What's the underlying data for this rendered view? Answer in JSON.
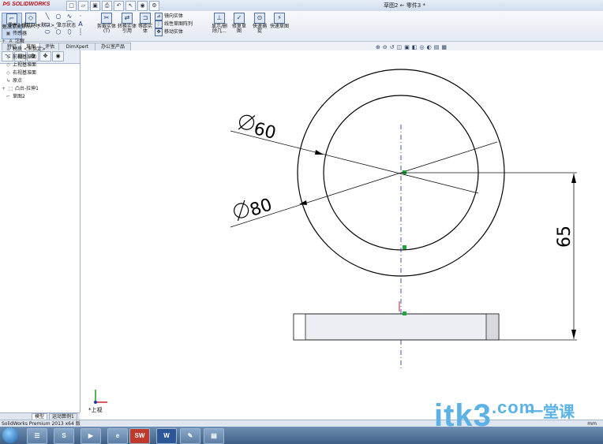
{
  "app": {
    "logo": "SOLIDWORKS",
    "window_title": "草图2 ← 零件3 *"
  },
  "quick_access": [
    "new-icon",
    "open-icon",
    "save-icon",
    "print-icon",
    "undo-icon",
    "select-icon",
    "rebuild-icon",
    "options-icon"
  ],
  "ribbon": {
    "sketch_button": "退出草图",
    "smart_dim_button": "智能尺寸",
    "trim_button": "剪裁实体(T)",
    "convert_button": "转换实体引用",
    "offset_button": "等距实体",
    "mirror_label": "镜向实体",
    "linear_pattern_label": "线性草图阵列",
    "move_label": "移动实体",
    "display_relations_button": "显示/删除几...",
    "repair_button": "修复草图",
    "quick_snap_button": "快速捕捉",
    "rapid_sketch_button": "快速草图"
  },
  "tabs": [
    "特征",
    "草图",
    "评估",
    "DimXpert",
    "办公室产品"
  ],
  "active_tab": "草图",
  "tree": {
    "root": "零件3 (默认<<默认>_显示状态",
    "items": [
      "传感器",
      "注解",
      "材质 <未指定>",
      "前视基准面",
      "上视基准面",
      "右视基准面",
      "原点",
      "凸台-拉伸1",
      "草图2"
    ]
  },
  "drawing": {
    "dim_diameter_60": "60",
    "dim_diameter_80": "80",
    "dim_height_65": "65",
    "view_label": "*上视"
  },
  "bottom_tabs": [
    "模型",
    "运动算例1"
  ],
  "status": {
    "left": "SolidWorks Premium 2013 x64 版",
    "right": "mm"
  },
  "taskbar": {
    "word_app": "W",
    "sw_app": "SW"
  },
  "watermark": {
    "text": "itk3",
    "suffix": ".com",
    "cn": "一堂课"
  }
}
